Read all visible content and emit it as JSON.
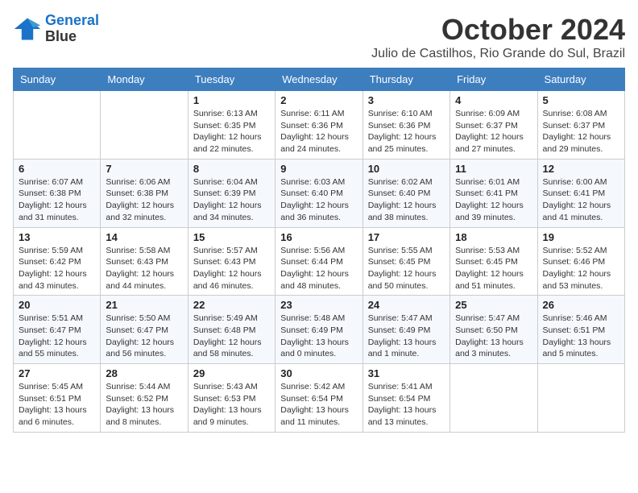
{
  "logo": {
    "line1": "General",
    "line2": "Blue"
  },
  "title": "October 2024",
  "location": "Julio de Castilhos, Rio Grande do Sul, Brazil",
  "days_header": [
    "Sunday",
    "Monday",
    "Tuesday",
    "Wednesday",
    "Thursday",
    "Friday",
    "Saturday"
  ],
  "weeks": [
    [
      null,
      null,
      {
        "day": 1,
        "sunrise": "6:13 AM",
        "sunset": "6:35 PM",
        "daylight": "12 hours and 22 minutes."
      },
      {
        "day": 2,
        "sunrise": "6:11 AM",
        "sunset": "6:36 PM",
        "daylight": "12 hours and 24 minutes."
      },
      {
        "day": 3,
        "sunrise": "6:10 AM",
        "sunset": "6:36 PM",
        "daylight": "12 hours and 25 minutes."
      },
      {
        "day": 4,
        "sunrise": "6:09 AM",
        "sunset": "6:37 PM",
        "daylight": "12 hours and 27 minutes."
      },
      {
        "day": 5,
        "sunrise": "6:08 AM",
        "sunset": "6:37 PM",
        "daylight": "12 hours and 29 minutes."
      }
    ],
    [
      {
        "day": 6,
        "sunrise": "6:07 AM",
        "sunset": "6:38 PM",
        "daylight": "12 hours and 31 minutes."
      },
      {
        "day": 7,
        "sunrise": "6:06 AM",
        "sunset": "6:38 PM",
        "daylight": "12 hours and 32 minutes."
      },
      {
        "day": 8,
        "sunrise": "6:04 AM",
        "sunset": "6:39 PM",
        "daylight": "12 hours and 34 minutes."
      },
      {
        "day": 9,
        "sunrise": "6:03 AM",
        "sunset": "6:40 PM",
        "daylight": "12 hours and 36 minutes."
      },
      {
        "day": 10,
        "sunrise": "6:02 AM",
        "sunset": "6:40 PM",
        "daylight": "12 hours and 38 minutes."
      },
      {
        "day": 11,
        "sunrise": "6:01 AM",
        "sunset": "6:41 PM",
        "daylight": "12 hours and 39 minutes."
      },
      {
        "day": 12,
        "sunrise": "6:00 AM",
        "sunset": "6:41 PM",
        "daylight": "12 hours and 41 minutes."
      }
    ],
    [
      {
        "day": 13,
        "sunrise": "5:59 AM",
        "sunset": "6:42 PM",
        "daylight": "12 hours and 43 minutes."
      },
      {
        "day": 14,
        "sunrise": "5:58 AM",
        "sunset": "6:43 PM",
        "daylight": "12 hours and 44 minutes."
      },
      {
        "day": 15,
        "sunrise": "5:57 AM",
        "sunset": "6:43 PM",
        "daylight": "12 hours and 46 minutes."
      },
      {
        "day": 16,
        "sunrise": "5:56 AM",
        "sunset": "6:44 PM",
        "daylight": "12 hours and 48 minutes."
      },
      {
        "day": 17,
        "sunrise": "5:55 AM",
        "sunset": "6:45 PM",
        "daylight": "12 hours and 50 minutes."
      },
      {
        "day": 18,
        "sunrise": "5:53 AM",
        "sunset": "6:45 PM",
        "daylight": "12 hours and 51 minutes."
      },
      {
        "day": 19,
        "sunrise": "5:52 AM",
        "sunset": "6:46 PM",
        "daylight": "12 hours and 53 minutes."
      }
    ],
    [
      {
        "day": 20,
        "sunrise": "5:51 AM",
        "sunset": "6:47 PM",
        "daylight": "12 hours and 55 minutes."
      },
      {
        "day": 21,
        "sunrise": "5:50 AM",
        "sunset": "6:47 PM",
        "daylight": "12 hours and 56 minutes."
      },
      {
        "day": 22,
        "sunrise": "5:49 AM",
        "sunset": "6:48 PM",
        "daylight": "12 hours and 58 minutes."
      },
      {
        "day": 23,
        "sunrise": "5:48 AM",
        "sunset": "6:49 PM",
        "daylight": "13 hours and 0 minutes."
      },
      {
        "day": 24,
        "sunrise": "5:47 AM",
        "sunset": "6:49 PM",
        "daylight": "13 hours and 1 minute."
      },
      {
        "day": 25,
        "sunrise": "5:47 AM",
        "sunset": "6:50 PM",
        "daylight": "13 hours and 3 minutes."
      },
      {
        "day": 26,
        "sunrise": "5:46 AM",
        "sunset": "6:51 PM",
        "daylight": "13 hours and 5 minutes."
      }
    ],
    [
      {
        "day": 27,
        "sunrise": "5:45 AM",
        "sunset": "6:51 PM",
        "daylight": "13 hours and 6 minutes."
      },
      {
        "day": 28,
        "sunrise": "5:44 AM",
        "sunset": "6:52 PM",
        "daylight": "13 hours and 8 minutes."
      },
      {
        "day": 29,
        "sunrise": "5:43 AM",
        "sunset": "6:53 PM",
        "daylight": "13 hours and 9 minutes."
      },
      {
        "day": 30,
        "sunrise": "5:42 AM",
        "sunset": "6:54 PM",
        "daylight": "13 hours and 11 minutes."
      },
      {
        "day": 31,
        "sunrise": "5:41 AM",
        "sunset": "6:54 PM",
        "daylight": "13 hours and 13 minutes."
      },
      null,
      null
    ]
  ]
}
